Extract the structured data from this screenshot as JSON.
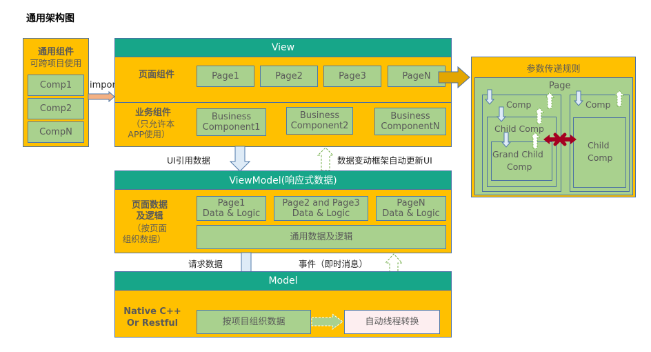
{
  "title": "通用架构图",
  "common_components": {
    "title": "通用组件",
    "subtitle": "可跨项目使用",
    "items": [
      "Comp1",
      "Comp2",
      "CompN"
    ]
  },
  "import_label": "import",
  "view": {
    "header": "View",
    "page_section_label": "页面组件",
    "pages": [
      "Page1",
      "Page2",
      "Page3",
      "PageN"
    ],
    "business_section_label_line1": "业务组件",
    "business_section_label_line2": "（只允许本",
    "business_section_label_line3": "APP使用）",
    "business_components": [
      {
        "line1": "Business",
        "line2": "Component1"
      },
      {
        "line1": "Business",
        "line2": "Component2"
      },
      {
        "line1": "Business",
        "line2": "ComponentN"
      }
    ]
  },
  "arrows": {
    "ui_ref_data": "UI引用数据",
    "auto_update_ui": "数据变动框架自动更新UI",
    "request_data": "请求数据",
    "events": "事件（即时消息）"
  },
  "viewmodel": {
    "header": "ViewModel(响应式数据)",
    "label_line1": "页面数据",
    "label_line2": "及逻辑",
    "label_line3": "（按页面",
    "label_line4": "组织数据）",
    "page_logic": [
      {
        "line1": "Page1",
        "line2": "Data & Logic"
      },
      {
        "line1": "Page2 and Page3",
        "line2": "Data & Logic"
      },
      {
        "line1": "PageN",
        "line2": "Data & Logic"
      }
    ],
    "common_logic": "通用数据及逻辑"
  },
  "model": {
    "header": "Model",
    "label_line1": "Native C++",
    "label_line2": "Or Restful",
    "organize_data": "按项目组织数据",
    "thread_switch": "自动线程转换"
  },
  "param_rules": {
    "title": "参数传递规则",
    "page": "Page",
    "comp_left": "Comp",
    "child_comp_left": "Child Comp",
    "grand_child_line1": "Grand Child",
    "grand_child_line2": "Comp",
    "comp_right": "Comp",
    "child_comp_right_line1": "Child",
    "child_comp_right_line2": "Comp"
  },
  "colors": {
    "panel": "#FFC000",
    "header": "#17A689",
    "box": "#A9D18E",
    "border": "#4A6FA5",
    "thread_box": "#FDEEF0",
    "forbidden": "#A50021"
  }
}
